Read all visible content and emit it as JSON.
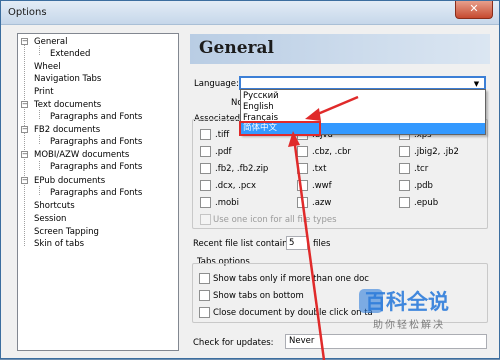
{
  "window": {
    "title": "Options",
    "close_glyph": "✕"
  },
  "tree": {
    "items": [
      "General",
      "Extended",
      "Wheel",
      "Navigation Tabs",
      "Print",
      "Text documents",
      "Paragraphs and Fonts",
      "FB2 documents",
      "Paragraphs and Fonts",
      "MOBI/AZW documents",
      "Paragraphs and Fonts",
      "EPub documents",
      "Paragraphs and Fonts",
      "Shortcuts",
      "Session",
      "Screen Tapping",
      "Skin of tabs"
    ],
    "expander_minus": "−"
  },
  "general": {
    "header": "General",
    "language_label": "Language:",
    "language_value": "",
    "language_options": [
      "Русский",
      "English",
      "Français",
      "简体中文"
    ],
    "no_label": "No",
    "associated_label": "Associated",
    "file_types": [
      ".tiff",
      ".djvu",
      ".xps",
      ".pdf",
      ".cbz, .cbr",
      ".jbig2, .jb2",
      ".fb2, .fb2.zip",
      ".txt",
      ".tcr",
      ".dcx, .pcx",
      ".wwf",
      ".pdb",
      ".mobi",
      ".azw",
      ".epub"
    ],
    "use_one_icon": "Use one icon for all file types",
    "recent_label": "Recent file list contains:",
    "recent_value": "5",
    "recent_suffix": "files",
    "tabs_options_label": "Tabs options",
    "tab_checks": [
      "Show tabs only if more than one doc",
      "Show tabs on bottom",
      "Close document by double click on ta"
    ],
    "check_updates_label": "Check for updates:",
    "check_updates_value": "Never"
  },
  "watermark": {
    "big": "百科全说",
    "small": "助你轻松解决"
  },
  "colors": {
    "accent": "#3399ff",
    "annotation_red": "#e02a2a",
    "header_gradient": "#b9cde4"
  }
}
